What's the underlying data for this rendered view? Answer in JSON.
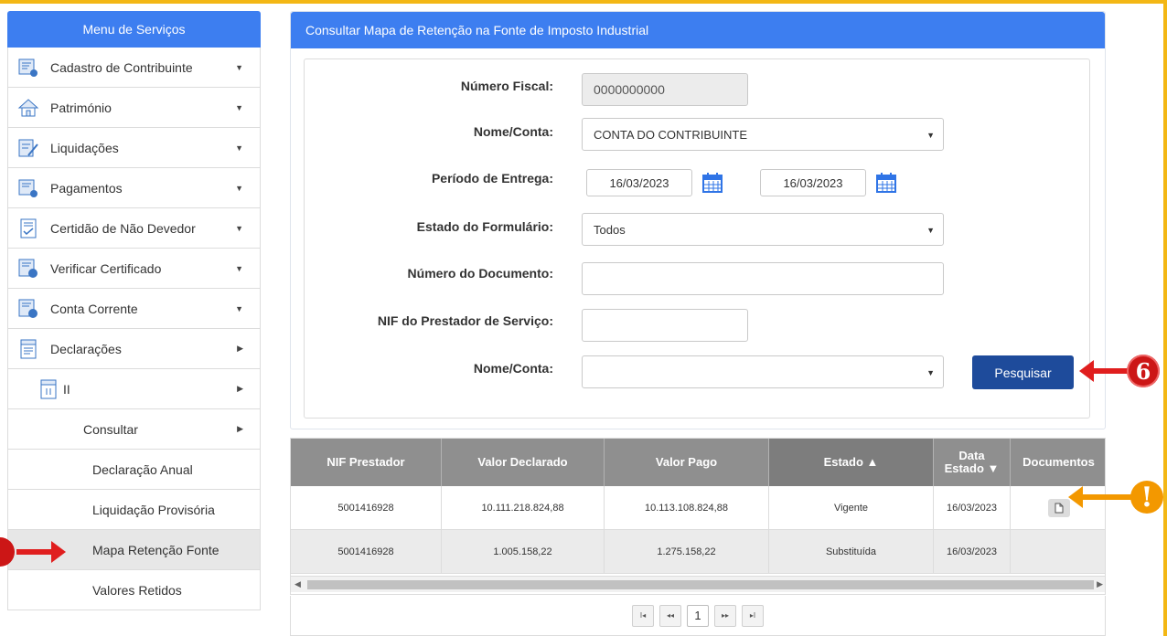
{
  "sidebar": {
    "title": "Menu de Serviços",
    "items": [
      {
        "label": "Cadastro de Contribuinte"
      },
      {
        "label": "Património"
      },
      {
        "label": "Liquidações"
      },
      {
        "label": "Pagamentos"
      },
      {
        "label": "Certidão de Não Devedor"
      },
      {
        "label": "Verificar Certificado"
      },
      {
        "label": "Conta Corrente"
      },
      {
        "label": "Declarações"
      },
      {
        "label": "II"
      },
      {
        "label": "Consultar"
      },
      {
        "label": "Declaração Anual"
      },
      {
        "label": "Liquidação Provisória"
      },
      {
        "label": "Mapa Retenção Fonte"
      },
      {
        "label": "Valores Retidos"
      }
    ]
  },
  "panel": {
    "title": "Consultar Mapa de Retenção na Fonte de Imposto Industrial"
  },
  "form": {
    "numero_fiscal_label": "Número Fiscal:",
    "numero_fiscal_value": "0000000000",
    "nome_conta_label": "Nome/Conta:",
    "nome_conta_value": "CONTA DO CONTRIBUINTE",
    "periodo_label": "Período de Entrega:",
    "periodo_from": "16/03/2023",
    "periodo_to": "16/03/2023",
    "estado_label": "Estado do Formulário:",
    "estado_value": "Todos",
    "numero_doc_label": "Número do Documento:",
    "numero_doc_value": "",
    "nif_prestador_label": "NIF do Prestador de Serviço:",
    "nif_prestador_value": "",
    "nome_conta2_label": "Nome/Conta:",
    "nome_conta2_value": "",
    "search_button": "Pesquisar"
  },
  "table": {
    "headers": [
      "NIF Prestador",
      "Valor Declarado",
      "Valor Pago",
      "Estado ▲",
      "Data\nEstado ▾",
      "Documentos"
    ],
    "header_data": "Data",
    "header_estado_sort": "Estado ▼",
    "rows": [
      {
        "nif": "5001416928",
        "declarado": "10.111.218.824,88",
        "pago": "10.113.108.824,88",
        "estado": "Vigente",
        "data": "16/03/2023",
        "doc": true
      },
      {
        "nif": "5001416928",
        "declarado": "1.005.158,22",
        "pago": "1.275.158,22",
        "estado": "Substituída",
        "data": "16/03/2023",
        "doc": false
      }
    ]
  },
  "pager": {
    "first": "I◂",
    "prev": "◂◂",
    "current": "1",
    "next": "▸▸",
    "last": "▸I"
  },
  "annotations": {
    "step_number": "6",
    "warning": "!"
  },
  "colors": {
    "accent": "#3d7ef0",
    "button": "#1e4b9b",
    "stripe": "#f3b715",
    "arrow_red": "#e01e1e",
    "arrow_orange": "#f39800"
  }
}
